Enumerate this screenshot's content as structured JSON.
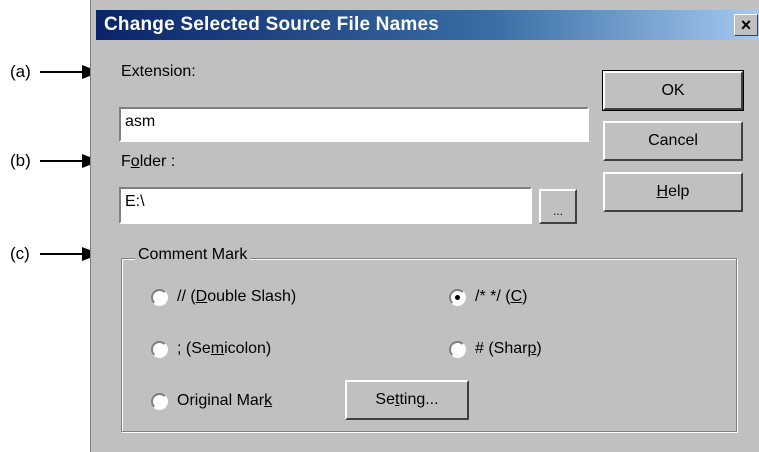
{
  "callouts": [
    {
      "label": "(a)"
    },
    {
      "label": "(b)"
    },
    {
      "label": "(c)"
    }
  ],
  "dialog": {
    "title": "Change Selected Source File Names",
    "close_glyph": "×",
    "extension_label": "Extension:",
    "extension_value": "asm",
    "folder_label_pre": "F",
    "folder_label_u": "o",
    "folder_label_post": "lder :",
    "folder_value": "E:\\",
    "browse_label": "...",
    "ok_label": "OK",
    "cancel_label": "Cancel",
    "help_u": "H",
    "help_rest": "elp",
    "group_title": "Comment Mark",
    "radios": {
      "double_slash": {
        "pre": "// (",
        "u": "D",
        "post": "ouble Slash)",
        "selected": false
      },
      "c_style": {
        "pre": "/* */ (",
        "u": "C",
        "post": ")",
        "selected": true
      },
      "semicolon": {
        "pre": "; (Se",
        "u": "m",
        "post": "icolon)",
        "selected": false
      },
      "sharp": {
        "pre": "# (Shar",
        "u": "p",
        "post": ")",
        "selected": false
      },
      "original": {
        "pre": "Original Mar",
        "u": "k",
        "post": "",
        "selected": false
      }
    },
    "setting_pre": "Se",
    "setting_u": "t",
    "setting_post": "ting..."
  },
  "colors": {
    "title_bar": "#0a246a",
    "dialog_face": "#c0c0c0"
  }
}
